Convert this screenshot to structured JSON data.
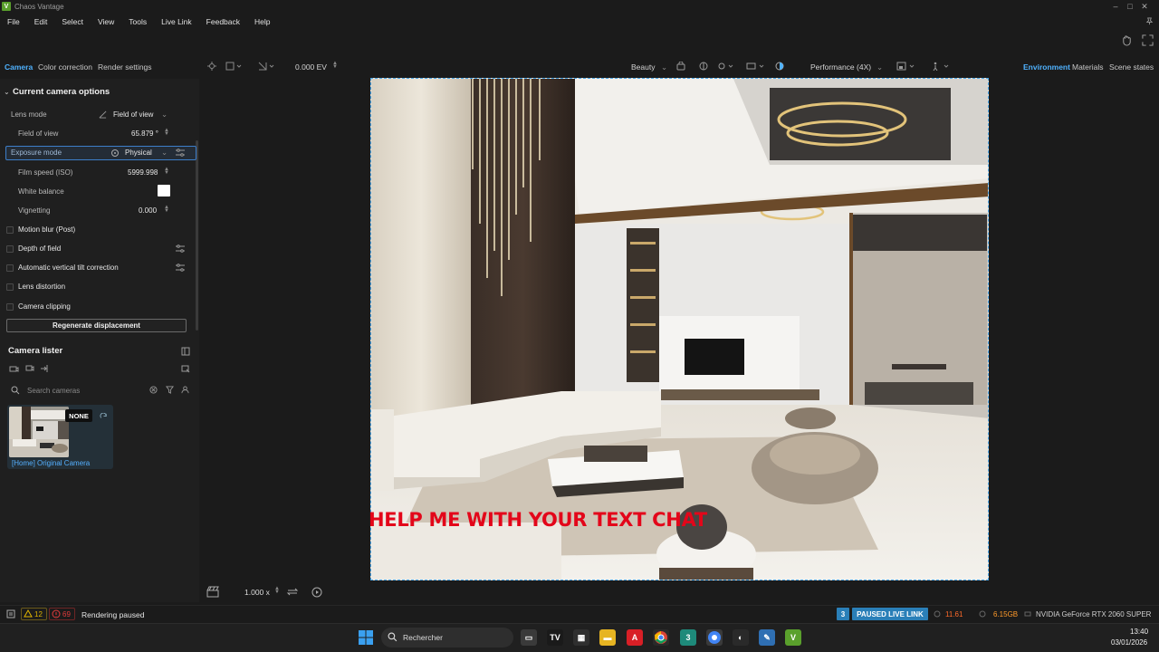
{
  "window": {
    "title": "Chaos Vantage"
  },
  "menu": [
    "File",
    "Edit",
    "Select",
    "View",
    "Tools",
    "Live Link",
    "Feedback",
    "Help"
  ],
  "left_tabs": [
    "Camera",
    "Color correction",
    "Render settings"
  ],
  "right_tabs": [
    "Environment",
    "Materials",
    "Scene states"
  ],
  "viewport_toolbar": {
    "ev_value": "0.000 EV",
    "render_mode": "Beauty",
    "quality": "Performance (4X)"
  },
  "camera_options": {
    "title": "Current camera options",
    "lens_mode_label": "Lens mode",
    "lens_mode_value": "Field of view",
    "fov_label": "Field of view",
    "fov_value": "65.879 °",
    "exposure_mode_label": "Exposure mode",
    "exposure_mode_value": "Physical",
    "iso_label": "Film speed (ISO)",
    "iso_value": "5999.998",
    "white_balance_label": "White balance",
    "white_balance_color": "#ffffff",
    "vignetting_label": "Vignetting",
    "vignetting_value": "0.000",
    "checkboxes": [
      "Motion blur (Post)",
      "Depth of field",
      "Automatic vertical tilt correction",
      "Lens distortion",
      "Camera clipping"
    ],
    "regen_button": "Regenerate displacement"
  },
  "camera_lister": {
    "title": "Camera lister",
    "search_placeholder": "Search cameras",
    "camera_badge": "NONE",
    "camera_name": "[Home] Original Camera"
  },
  "overlay_text": "HELP ME WITH YOUR TEXT CHAT",
  "viewport_bottom": {
    "zoom": "1.000 x"
  },
  "status": {
    "warnings": "12",
    "errors": "69",
    "render_state": "Rendering paused",
    "live_link_num": "3",
    "live_link": "PAUSED LIVE LINK",
    "fps": "11.61",
    "vram": "6.15GB",
    "gpu": "NVIDIA GeForce RTX 2060 SUPER"
  },
  "taskbar": {
    "search": "Rechercher",
    "time": "13:40",
    "date": "03/01/2026"
  },
  "colors": {
    "accent": "#4fb2ff",
    "live_link_badge": "#2a7fb8",
    "overlay_text": "#e3061a",
    "warning": "#e0b400",
    "error": "#e23b3b",
    "fps": "#ff6a2a"
  }
}
